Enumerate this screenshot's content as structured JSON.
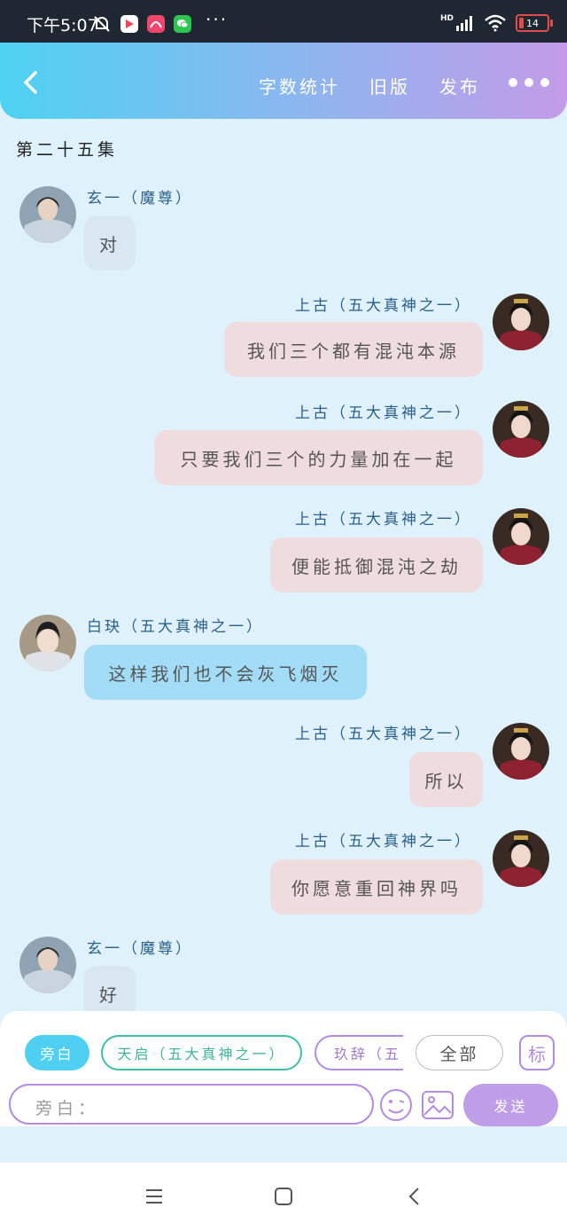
{
  "status_bar": {
    "time": "下午5:07",
    "network": "HD",
    "battery": "14",
    "app_icons": [
      "mute-bell-icon",
      "video-app-icon",
      "mi-app-icon",
      "wechat-icon"
    ],
    "more": "···"
  },
  "header": {
    "back_icon": "chevron-left-icon",
    "word_count": "字数统计",
    "old_version": "旧版",
    "publish": "发布",
    "more_icon": "more-dots-icon",
    "gradient": [
      "#4dd2f2",
      "#c39be8"
    ]
  },
  "episode_title": "第二十五集",
  "messages": [
    {
      "speaker": "玄一（魔尊）",
      "text": "对",
      "side": "left"
    },
    {
      "speaker": "上古（五大真神之一）",
      "text": "我们三个都有混沌本源",
      "side": "right"
    },
    {
      "speaker": "上古（五大真神之一）",
      "text": "只要我们三个的力量加在一起",
      "side": "right"
    },
    {
      "speaker": "上古（五大真神之一）",
      "text": "便能抵御混沌之劫",
      "side": "right"
    },
    {
      "speaker": "白玦（五大真神之一）",
      "text": "这样我们也不会灰飞烟灭",
      "side": "left"
    },
    {
      "speaker": "上古（五大真神之一）",
      "text": "所以",
      "side": "right"
    },
    {
      "speaker": "上古（五大真神之一）",
      "text": "你愿意重回神界吗",
      "side": "right"
    },
    {
      "speaker": "玄一（魔尊）",
      "text": "好",
      "side": "left"
    }
  ],
  "composer": {
    "chips": [
      "旁白",
      "天启（五大真神之一）",
      "玖辞（五大真神之一）"
    ],
    "chip_purple_visible": "玖辞（五",
    "all_label": "全部",
    "tag_label": "标",
    "input_placeholder": "旁白：",
    "send_label": "发送",
    "emoji_icon": "smiley-icon",
    "image_icon": "image-icon"
  },
  "nav_bar": {
    "menu_icon": "menu-icon",
    "home_icon": "home-square-icon",
    "back_icon": "back-arrow-icon"
  },
  "colors": {
    "background": "#dff2fb",
    "bubble_left_gray": "#d8e7f1",
    "bubble_right_pink": "#efdcdf",
    "bubble_left_blue": "#a2dcf7",
    "speaker_name": "#2a5f8a",
    "accent_purple": "#bf9ee8",
    "accent_cyan": "#4fd0f2"
  }
}
